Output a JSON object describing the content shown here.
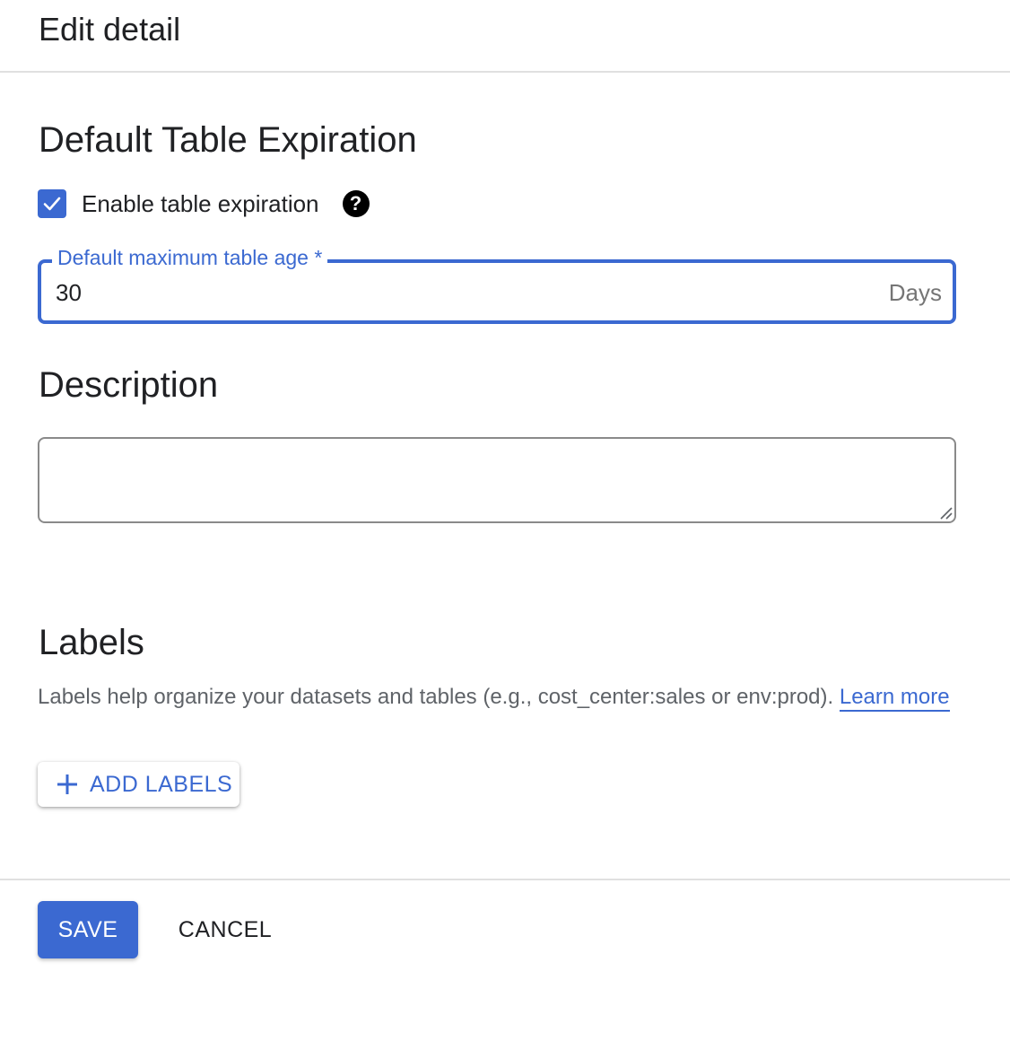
{
  "header": {
    "title": "Edit detail"
  },
  "expiration": {
    "section_title": "Default Table Expiration",
    "checkbox_label": "Enable table expiration",
    "checkbox_checked": true,
    "help_icon": "help-circle-icon",
    "age_field_label": "Default maximum table age *",
    "age_value": "30",
    "age_suffix": "Days"
  },
  "description": {
    "section_title": "Description",
    "value": "",
    "placeholder": ""
  },
  "labels": {
    "section_title": "Labels",
    "help_text": "Labels help organize your datasets and tables (e.g., cost_center:sales or env:prod). ",
    "learn_more": "Learn more",
    "add_button_icon": "plus-icon",
    "add_button": "ADD LABELS"
  },
  "footer": {
    "save": "SAVE",
    "cancel": "CANCEL"
  },
  "colors": {
    "accent": "#3b69d1",
    "text": "#202124",
    "muted": "#5f6368",
    "divider": "#e0e0e0"
  }
}
